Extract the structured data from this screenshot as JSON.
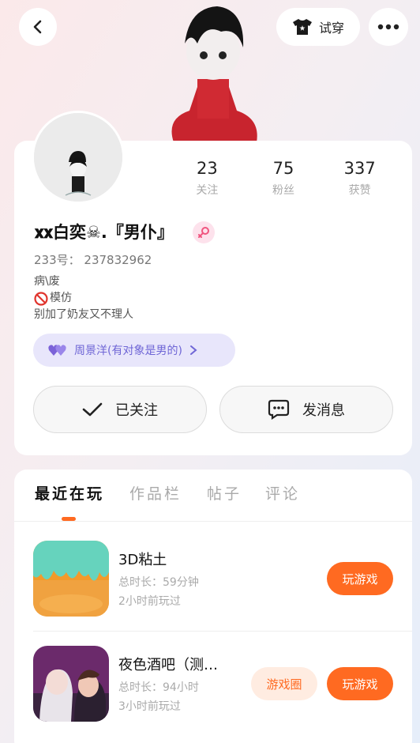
{
  "topbar": {
    "tryon_label": "试穿"
  },
  "profile": {
    "username": "𝐱𝐱白奕☠.『男仆』",
    "uid_label": "233号：",
    "uid_value": "237832962",
    "bio_lines": [
      "病\\废",
      "模仿",
      "别加了奶友又不理人"
    ],
    "tag_text": "周景洋(有对象是男的)"
  },
  "stats": [
    {
      "value": "23",
      "label": "关注"
    },
    {
      "value": "75",
      "label": "粉丝"
    },
    {
      "value": "337",
      "label": "获赞"
    }
  ],
  "actions": {
    "follow_label": "已关注",
    "message_label": "发消息"
  },
  "tabs": [
    "最近在玩",
    "作品栏",
    "帖子",
    "评论"
  ],
  "games": [
    {
      "title": "3D粘土",
      "duration": "总时长：59分钟",
      "last_played": "2小时前玩过",
      "play_label": "玩游戏"
    },
    {
      "title": "夜色酒吧（测…",
      "duration": "总时长：94小时",
      "last_played": "3小时前玩过",
      "circle_label": "游戏圈",
      "play_label": "玩游戏"
    }
  ],
  "colors": {
    "accent": "#ff6a21",
    "tag_purple": "#6f66d6"
  }
}
